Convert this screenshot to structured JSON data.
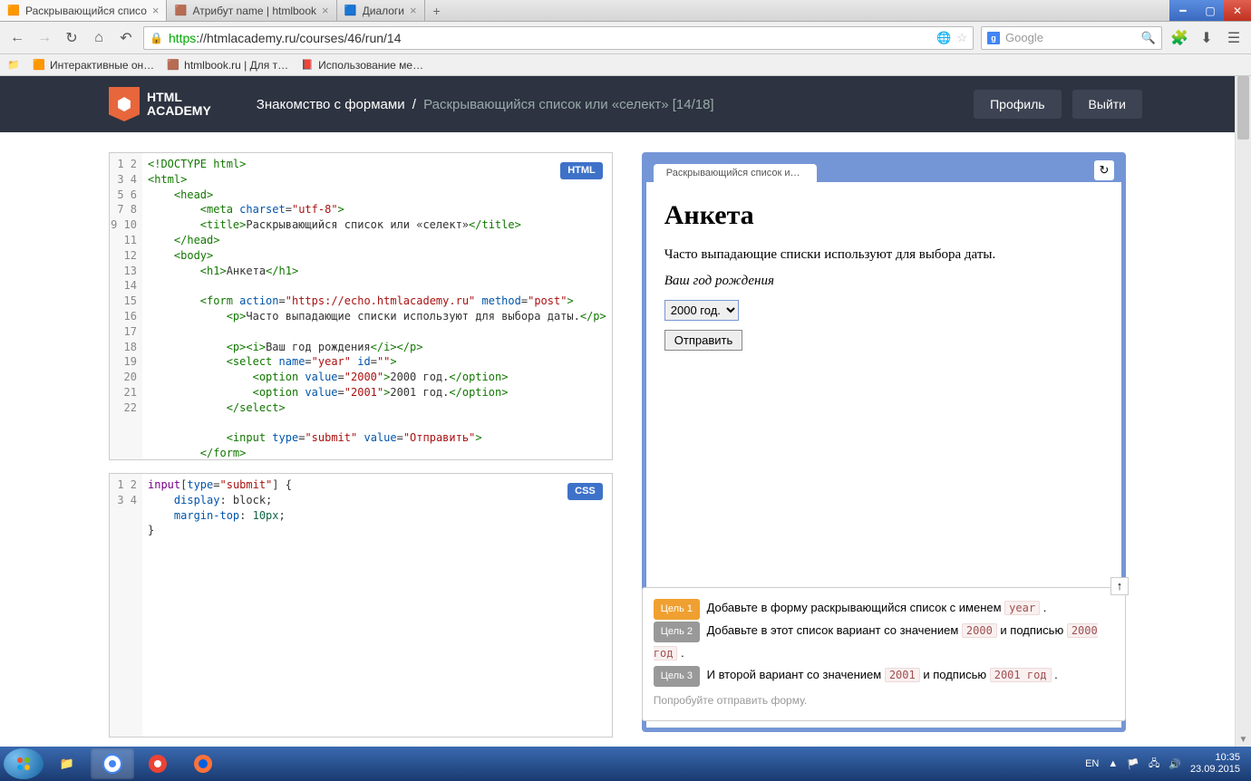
{
  "browser": {
    "tabs": [
      {
        "title": "Раскрывающийся списо",
        "icon": "🟧"
      },
      {
        "title": "Атрибут name | htmlbook",
        "icon": "🟫"
      },
      {
        "title": "Диалоги",
        "icon": "🟦"
      }
    ],
    "url_proto": "https",
    "url_text": "://htmlacademy.ru/courses/46/run/14",
    "search_placeholder": "Google",
    "bookmarks": [
      {
        "label": "Интерактивные он…",
        "icon": "🟧"
      },
      {
        "label": "htmlbook.ru | Для т…",
        "icon": "🟫"
      },
      {
        "label": "Использование ме…",
        "icon": "📕"
      }
    ]
  },
  "academy": {
    "logo_top": "HTML",
    "logo_bot": "ACADEMY",
    "crumb_parent": "Знакомство с формами",
    "crumb_current": "Раскрывающийся список или «селект» [14/18]",
    "profile": "Профиль",
    "logout": "Выйти"
  },
  "editor": {
    "html_badge": "HTML",
    "css_badge": "CSS",
    "html_lines": [
      "1",
      "2",
      "3",
      "4",
      "5",
      "6",
      "7",
      "8",
      "9",
      "10",
      "11",
      "12",
      "13",
      "14",
      "15",
      "16",
      "17",
      "18",
      "19",
      "20",
      "21",
      "22"
    ],
    "css_lines": [
      "1",
      "2",
      "3",
      "4"
    ]
  },
  "preview": {
    "tab_title": "Раскрывающийся список или «сел",
    "h1": "Анкета",
    "p1": "Часто выпадающие списки используют для выбора даты.",
    "p2": "Ваш год рождения",
    "option": "2000 год.",
    "submit": "Отправить"
  },
  "goals": {
    "g1_label": "Цель 1",
    "g1_text_a": "Добавьте в форму раскрывающийся список с именем ",
    "g1_code": "year",
    "g2_label": "Цель 2",
    "g2_text_a": "Добавьте в этот список вариант со значением ",
    "g2_code1": "2000",
    "g2_text_b": " и подписью ",
    "g2_code2": "2000 год",
    "g3_label": "Цель 3",
    "g3_text_a": "И второй вариант со значением ",
    "g3_code1": "2001",
    "g3_text_b": " и подписью ",
    "g3_code2": "2001 год",
    "hint": "Попробуйте отправить форму."
  },
  "taskbar": {
    "lang": "EN",
    "time": "10:35",
    "date": "23.09.2015"
  }
}
